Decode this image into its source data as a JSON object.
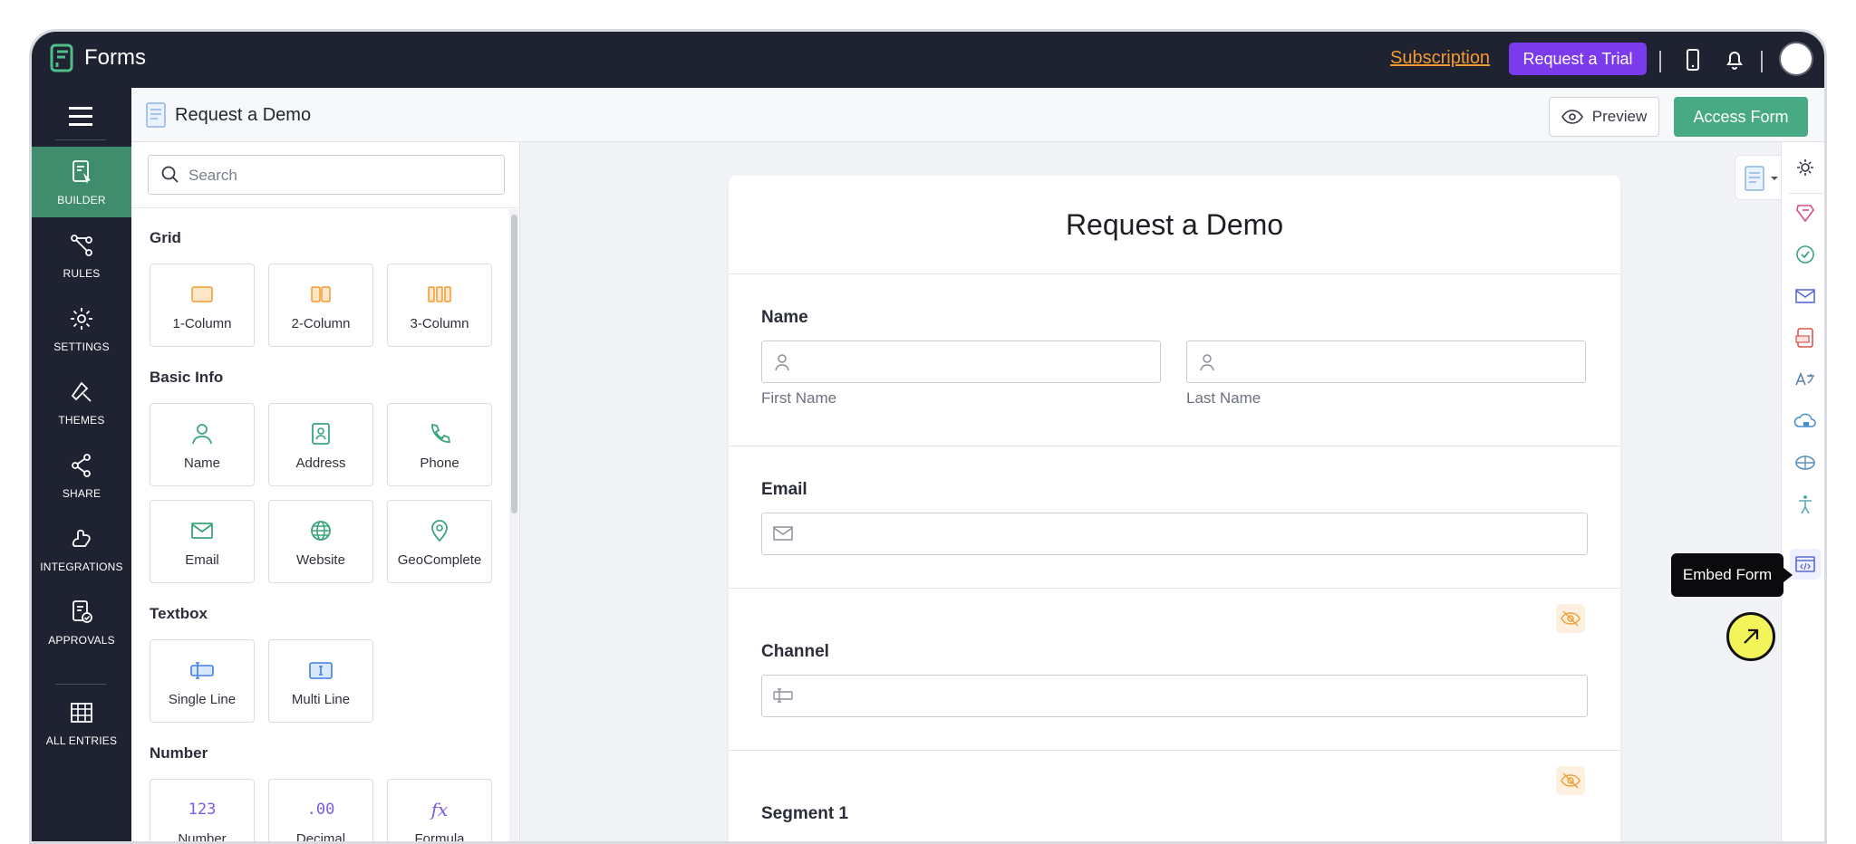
{
  "app": {
    "name": "Forms",
    "subscription_link": "Subscription",
    "trial_button": "Request a Trial"
  },
  "sidebar": {
    "items": [
      {
        "label": "BUILDER",
        "icon": "builder-icon",
        "active": true
      },
      {
        "label": "RULES",
        "icon": "rules-icon",
        "active": false
      },
      {
        "label": "SETTINGS",
        "icon": "gear-icon",
        "active": false
      },
      {
        "label": "THEMES",
        "icon": "themes-icon",
        "active": false
      },
      {
        "label": "SHARE",
        "icon": "share-icon",
        "active": false
      },
      {
        "label": "INTEGRATIONS",
        "icon": "integrations-icon",
        "active": false
      },
      {
        "label": "APPROVALS",
        "icon": "approvals-icon",
        "active": false
      },
      {
        "label": "ALL ENTRIES",
        "icon": "table-icon",
        "active": false
      }
    ]
  },
  "toolbar": {
    "form_name": "Request a Demo",
    "preview_label": "Preview",
    "access_label": "Access Form"
  },
  "field_panel": {
    "search_placeholder": "Search",
    "sections": [
      {
        "title": "Grid",
        "fields": [
          "1-Column",
          "2-Column",
          "3-Column"
        ]
      },
      {
        "title": "Basic Info",
        "fields": [
          "Name",
          "Address",
          "Phone",
          "Email",
          "Website",
          "GeoComplete"
        ]
      },
      {
        "title": "Textbox",
        "fields": [
          "Single Line",
          "Multi Line"
        ]
      },
      {
        "title": "Number",
        "fields": [
          "Number",
          "Decimal",
          "Formula"
        ]
      }
    ],
    "number_icons": {
      "number": "123",
      "decimal": ".00",
      "formula": "fx"
    }
  },
  "form": {
    "title": "Request a Demo",
    "fields": [
      {
        "label": "Name",
        "sublabels": [
          "First Name",
          "Last Name"
        ]
      },
      {
        "label": "Email"
      },
      {
        "label": "Channel",
        "hidden": true
      },
      {
        "label": "Segment 1",
        "hidden": true
      }
    ]
  },
  "right_rail": {
    "icons": [
      "form-settings-icon",
      "payment-icon",
      "check-circle-icon",
      "mail-icon",
      "pdf-icon",
      "translate-icon",
      "cloud-lock-icon",
      "globe-icon",
      "accessibility-icon",
      "embed-code-icon"
    ],
    "tooltip": "Embed Form"
  },
  "colors": {
    "topbar": "#1f2230",
    "accent_green": "#48a985",
    "trial_purple": "#7c3aed",
    "subscription_orange": "#f39a2d"
  }
}
